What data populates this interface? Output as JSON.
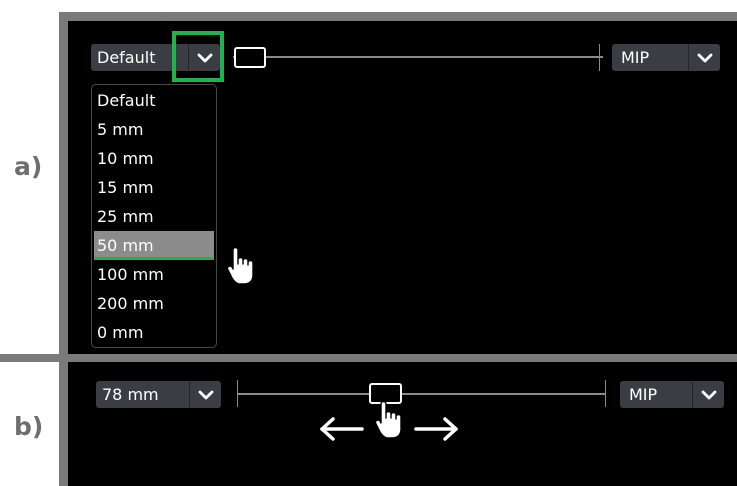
{
  "labels": {
    "part_a": "a)",
    "part_b": "b)"
  },
  "panel_a": {
    "thickness_select": {
      "value": "Default"
    },
    "dropdown": {
      "options": [
        "Default",
        "5 mm",
        "10 mm",
        "15 mm",
        "25 mm",
        "50 mm",
        "100 mm",
        "200 mm",
        "0 mm"
      ],
      "selected_index": 5,
      "selected": "50 mm"
    },
    "mode_select": {
      "value": "MIP"
    },
    "slider_position": 0.0
  },
  "panel_b": {
    "thickness_select": {
      "value": "78 mm"
    },
    "mode_select": {
      "value": "MIP"
    },
    "slider_position": 0.4
  },
  "colors": {
    "highlight": "#22b14c",
    "panel_background": "#000000",
    "frame": "#7a7a7a",
    "control": "#3a3d44",
    "selected_item": "#8c8c8c"
  },
  "icons": {
    "combo_arrow": "chevron-down-icon",
    "pointer": "hand-pointer-icon",
    "left_arrow": "arrow-left-icon",
    "right_arrow": "arrow-right-icon"
  }
}
